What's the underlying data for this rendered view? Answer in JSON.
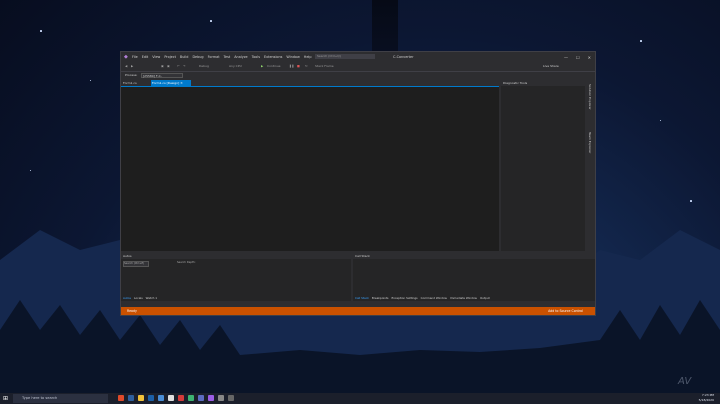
{
  "vs": {
    "menu": [
      "File",
      "Edit",
      "View",
      "Project",
      "Build",
      "Debug",
      "Format",
      "Test",
      "Analyze",
      "Tools",
      "Extensions",
      "Window",
      "Help"
    ],
    "search_placeholder": "Search (Ctrl+Q)",
    "solution_title": "C-Converter",
    "live_share": "Live Share",
    "toolbar": {
      "debug": "Debug",
      "any_cpu": "Any CPU",
      "continue": "Continue",
      "stack_frame": "Stack Frame"
    },
    "process_label": "Process:",
    "process_value": "[25580] F-C-Converter.exe",
    "tabs": [
      "Form1.cs",
      "Form1.cs [Design]"
    ],
    "diagnostic_tools": "Diagnostic Tools",
    "side_tabs": [
      "Solution Explorer",
      "Team Explorer"
    ],
    "autos": {
      "title": "Autos",
      "search": "Search (Ctrl+E)",
      "depth": "Search Depth:",
      "tabs": [
        "Autos",
        "Locals",
        "Watch 1"
      ]
    },
    "callstack": {
      "title": "Call Stack",
      "tabs": [
        "Call Stack",
        "Breakpoints",
        "Exception Settings",
        "Command Window",
        "Immediate Window",
        "Output"
      ]
    },
    "status": {
      "ready": "Ready",
      "source_control": "Add to Source Control"
    }
  },
  "taskbar": {
    "search_placeholder": "Type here to search",
    "time": "7:23 PM",
    "date": "5/18/2020"
  },
  "watermark": "AV"
}
